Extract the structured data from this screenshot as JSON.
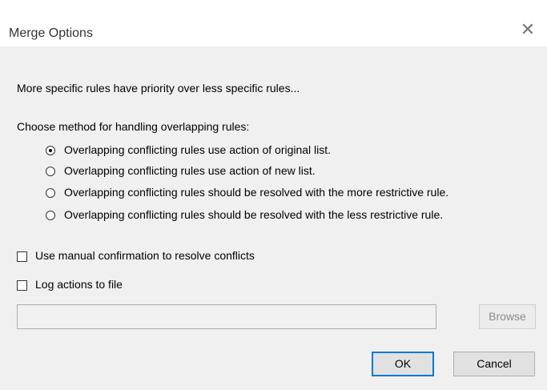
{
  "window": {
    "title": "Merge Options",
    "close_icon": "close-icon"
  },
  "intro_text": "More specific rules have priority over less specific rules...",
  "method_group": {
    "label": "Choose method for handling overlapping rules:",
    "options": [
      {
        "label": "Overlapping conflicting rules use action of original list.",
        "selected": true
      },
      {
        "label": "Overlapping conflicting rules use action of new list.",
        "selected": false
      },
      {
        "label": "Overlapping conflicting rules should be resolved with the more restrictive rule.",
        "selected": false
      },
      {
        "label": "Overlapping conflicting rules should be resolved with the less restrictive rule.",
        "selected": false
      }
    ]
  },
  "manual_confirmation": {
    "label": "Use manual confirmation to resolve conflicts",
    "checked": false
  },
  "log_actions": {
    "label": "Log actions to file",
    "checked": false
  },
  "log_path": {
    "value": "",
    "placeholder": ""
  },
  "buttons": {
    "browse": "Browse",
    "ok": "OK",
    "cancel": "Cancel"
  },
  "colors": {
    "dialog_bg": "#f0f0f0",
    "titlebar_bg": "#ffffff",
    "accent": "#0078d7"
  }
}
